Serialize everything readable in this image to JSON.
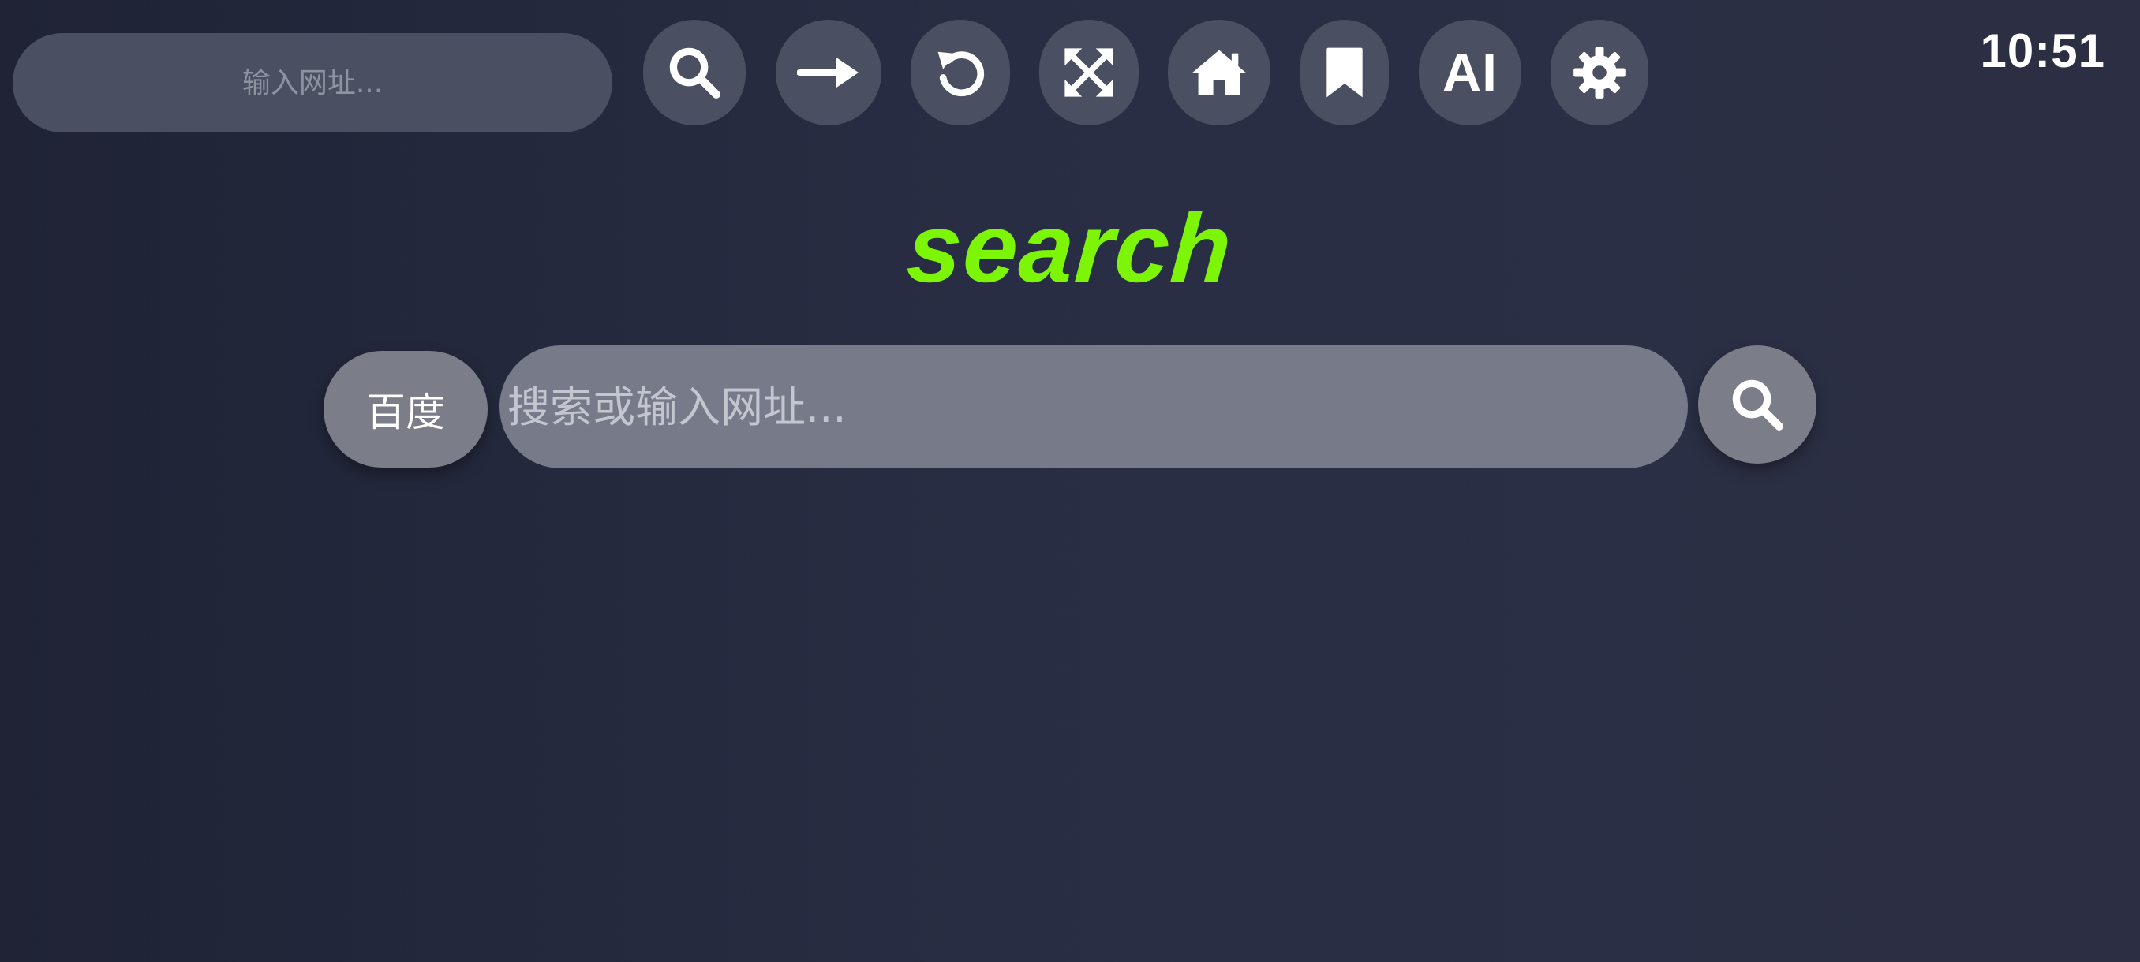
{
  "topbar": {
    "url_placeholder": "输入网址...",
    "buttons": [
      {
        "name": "search-button",
        "icon": "search-icon"
      },
      {
        "name": "go-button",
        "icon": "arrow-right-icon"
      },
      {
        "name": "reload-button",
        "icon": "reload-icon"
      },
      {
        "name": "fullscreen-button",
        "icon": "expand-icon"
      },
      {
        "name": "home-button",
        "icon": "home-icon"
      },
      {
        "name": "bookmark-button",
        "icon": "bookmark-icon"
      },
      {
        "name": "ai-button",
        "label": "AI"
      },
      {
        "name": "settings-button",
        "icon": "gear-icon"
      }
    ],
    "clock": "10:51"
  },
  "main": {
    "logo_text": "search",
    "engine_label": "百度",
    "search_placeholder": "搜索或输入网址..."
  },
  "colors": {
    "accent": "#7cf507",
    "button_bg": "#4a4f61",
    "search_bg": "#777a88"
  }
}
